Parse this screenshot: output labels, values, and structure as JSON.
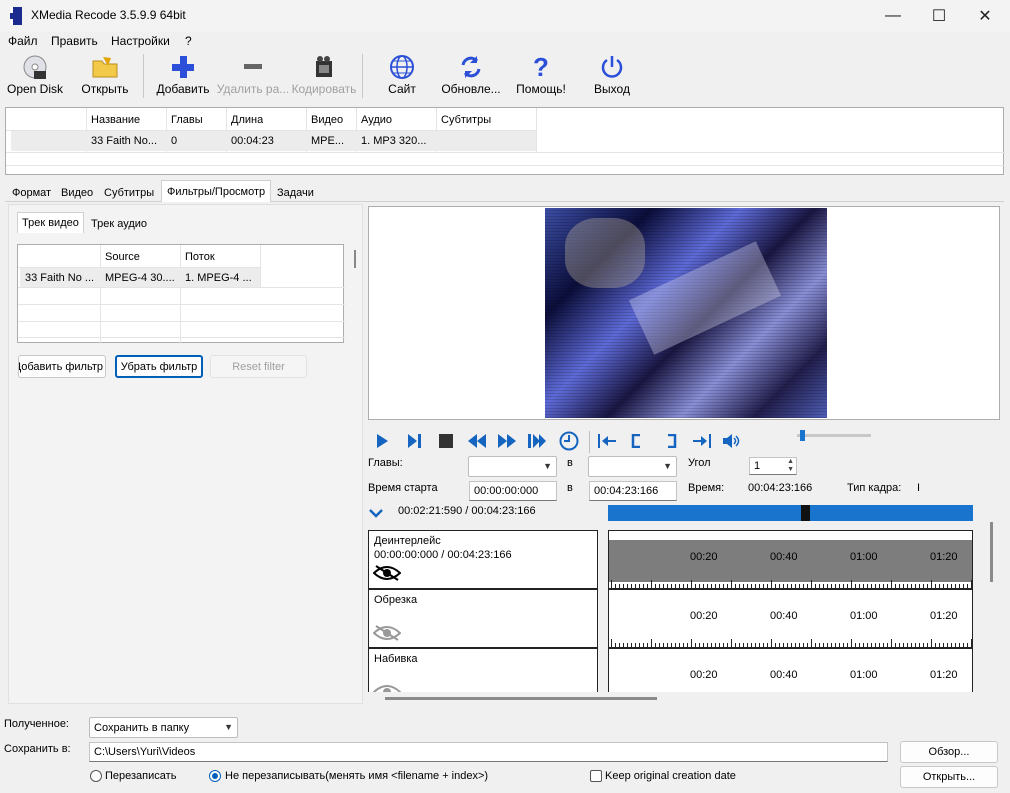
{
  "window": {
    "title": "XMedia Recode 3.5.9.9 64bit",
    "minimize": "—",
    "maximize": "☐",
    "close": "✕"
  },
  "menu": [
    "Файл",
    "Править",
    "Настройки",
    "?"
  ],
  "toolbar": {
    "open_disk": "Open Disk",
    "open": "Открыть",
    "add": "Добавить",
    "remove": "Удалить ра...",
    "encode": "Кодировать",
    "site": "Сайт",
    "update": "Обновле...",
    "help": "Помощь!",
    "exit": "Выход"
  },
  "file_table": {
    "headers": [
      "Название",
      "Главы",
      "Длина",
      "Видео",
      "Аудио",
      "Субтитры"
    ],
    "row": [
      "33 Faith No...",
      "0",
      "00:04:23",
      "MPE...",
      "1. MP3 320..."
    ]
  },
  "tabs": [
    "Формат",
    "Видео",
    "Субтитры",
    "Фильтры/Просмотр",
    "Задачи"
  ],
  "subtabs": [
    "Трек видео",
    "Трек аудио"
  ],
  "filter_table": {
    "headers": [
      "Source",
      "Поток"
    ],
    "row": [
      "33 Faith No ...",
      "MPEG-4 30....",
      "1. MPEG-4 ..."
    ]
  },
  "filter_buttons": {
    "add": "Добавить фильтр",
    "remove": "Убрать фильтр",
    "reset": "Reset filter"
  },
  "player": {
    "chapters_label": "Главы:",
    "in1": "в",
    "angle_label": "Угол",
    "angle_value": "1",
    "start_label": "Время старта",
    "start_value": "00:00:00:000",
    "in2": "в",
    "end_value": "00:04:23:166",
    "time_label": "Время:",
    "time_value": "00:04:23:166",
    "frame_label": "Тип кадра:",
    "frame_value": "I",
    "position": "00:02:21:590 / 00:04:23:166",
    "seek_fraction": 0.53
  },
  "tracks": [
    {
      "name": "Деинтерлейс",
      "time": "00:00:00:000 / 00:04:23:166",
      "active": true
    },
    {
      "name": "Обрезка",
      "time": "",
      "active": false
    },
    {
      "name": "Набивка",
      "time": "",
      "active": false
    }
  ],
  "timeline_ticks": [
    "00:20",
    "00:40",
    "01:00",
    "01:20"
  ],
  "output": {
    "received_label": "Полученное:",
    "received_value": "Сохранить в папку",
    "save_label": "Сохранить в:",
    "save_path": "C:\\Users\\Yuri\\Videos",
    "browse": "Обзор...",
    "open": "Открыть...",
    "overwrite": "Перезаписать",
    "no_overwrite": "Не перезаписывать(менять имя <filename + index>)",
    "keep_date": "Keep original creation date"
  },
  "colors": {
    "accent": "#1a73e8",
    "seek": "#1874cd",
    "toolbar_icon": "#2b4fd8"
  }
}
